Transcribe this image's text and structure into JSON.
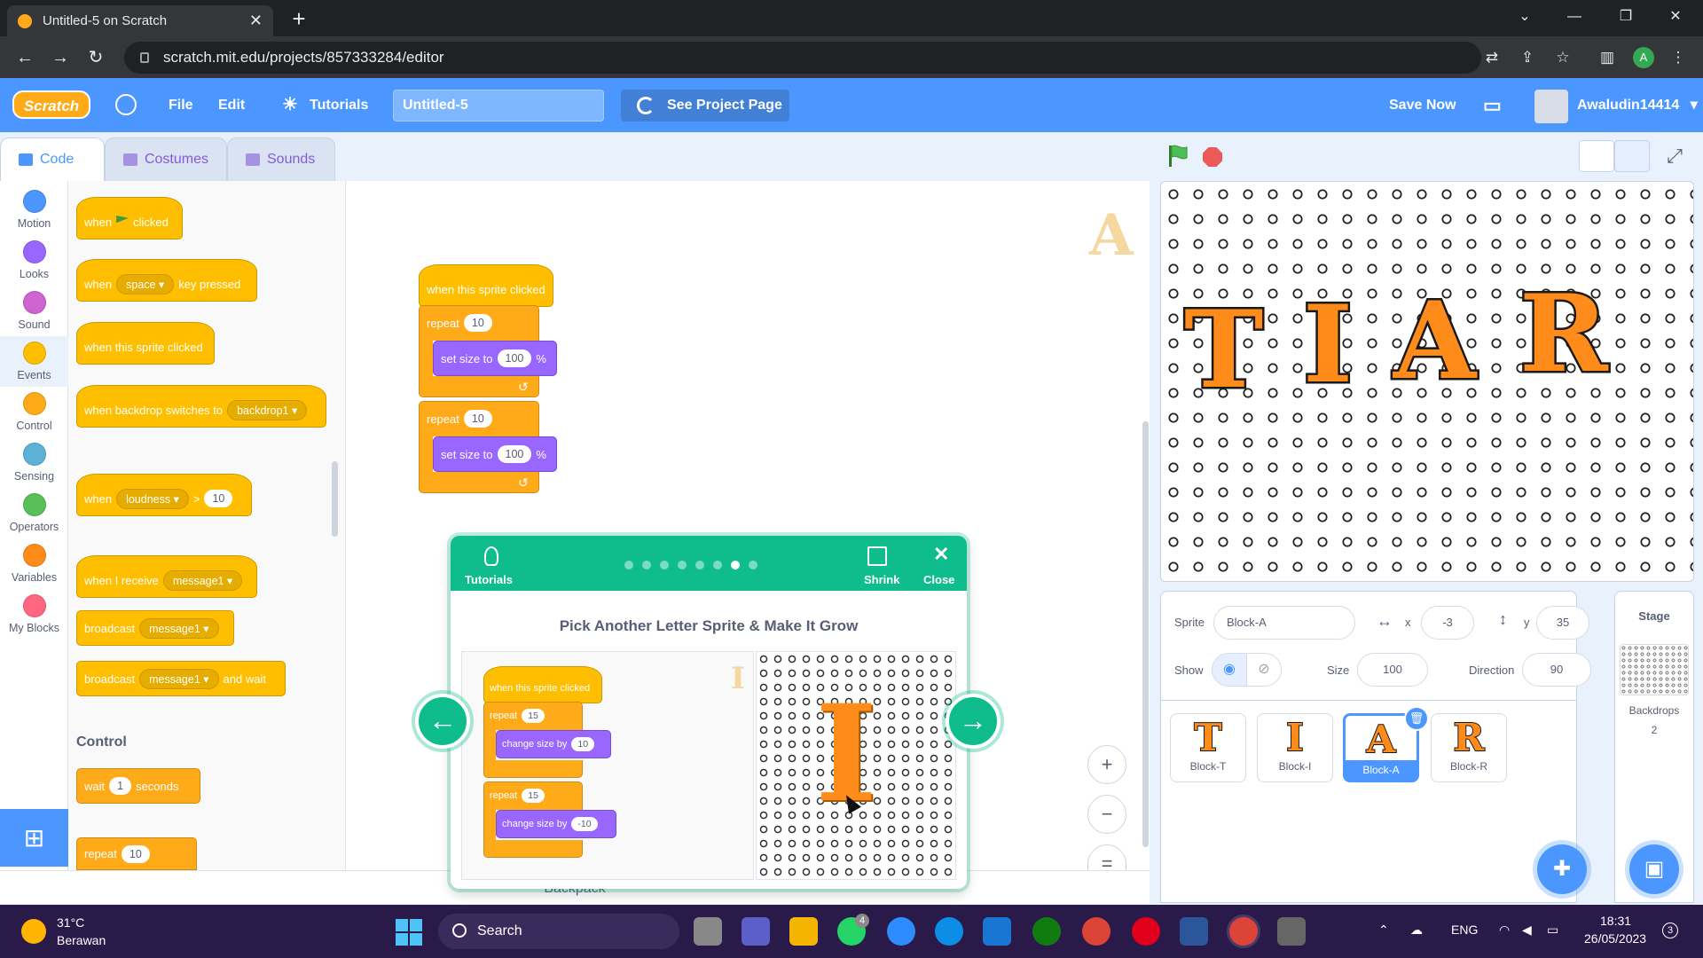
{
  "browser": {
    "tab_title": "Untitled-5 on Scratch",
    "tab_close": "✕",
    "new_tab": "+",
    "url": "scratch.mit.edu/projects/857333284/editor",
    "profile_initial": "A",
    "window_controls": [
      "⌄",
      "—",
      "❐",
      "✕"
    ]
  },
  "menubar": {
    "logo": "Scratch",
    "file": "File",
    "edit": "Edit",
    "tutorials": "Tutorials",
    "project_title": "Untitled-5",
    "see_project": "See Project Page",
    "save_now": "Save Now",
    "username": "Awaludin14414",
    "caret": "▾"
  },
  "tabs": {
    "code": "Code",
    "costumes": "Costumes",
    "sounds": "Sounds"
  },
  "categories": [
    {
      "label": "Motion",
      "color": "#4c97ff"
    },
    {
      "label": "Looks",
      "color": "#9966ff"
    },
    {
      "label": "Sound",
      "color": "#cf63cf"
    },
    {
      "label": "Events",
      "color": "#ffbf00"
    },
    {
      "label": "Control",
      "color": "#ffab19"
    },
    {
      "label": "Sensing",
      "color": "#5cb1d6"
    },
    {
      "label": "Operators",
      "color": "#59c059"
    },
    {
      "label": "Variables",
      "color": "#ff8c1a"
    },
    {
      "label": "My Blocks",
      "color": "#ff6680"
    }
  ],
  "palette": {
    "when": "when",
    "clicked": "clicked",
    "space": "space",
    "key_pressed": "key pressed",
    "when_sprite_clicked": "when this sprite clicked",
    "when_backdrop": "when backdrop switches to",
    "backdrop1": "backdrop1",
    "loudness": "loudness",
    "gt": ">",
    "loud_val": "10",
    "when_receive": "when I receive",
    "message1": "message1",
    "broadcast": "broadcast",
    "and_wait": "and wait",
    "control_heading": "Control",
    "wait": "wait",
    "wait_val": "1",
    "seconds": "seconds",
    "repeat": "repeat",
    "repeat_val": "10"
  },
  "workspace": {
    "hat": "when this sprite clicked",
    "repeat": "repeat",
    "repeat1_val": "10",
    "set_size": "set size to",
    "size1_val": "100",
    "pct": "%",
    "repeat2_val": "10",
    "size2_val": "100",
    "loop_arrow": "↺",
    "ghost_letter": "A",
    "zoom_in": "+",
    "zoom_out": "−",
    "zoom_reset": "="
  },
  "backpack": "Backpack",
  "tutorial": {
    "label": "Tutorials",
    "shrink": "Shrink",
    "close": "Close",
    "close_x": "✕",
    "title": "Pick Another Letter Sprite & Make It Grow",
    "dots_total": 8,
    "dots_active_index": 6,
    "hat": "when this sprite clicked",
    "repeat": "repeat",
    "repeat1_val": "15",
    "change_size": "change size by",
    "change1_val": "10",
    "repeat2_val": "15",
    "change2_val": "-10",
    "ghost_letter": "I",
    "stage_letter": "I",
    "prev_arrow": "←",
    "next_arrow": "→"
  },
  "stage": {
    "letters": [
      "T",
      "I",
      "A",
      "R"
    ]
  },
  "sprite_info": {
    "sprite_label": "Sprite",
    "sprite_name": "Block-A",
    "x_label": "x",
    "x_val": "-3",
    "y_label": "y",
    "y_val": "35",
    "show_label": "Show",
    "size_label": "Size",
    "size_val": "100",
    "direction_label": "Direction",
    "direction_val": "90"
  },
  "sprites": [
    {
      "letter": "T",
      "name": "Block-T"
    },
    {
      "letter": "I",
      "name": "Block-I"
    },
    {
      "letter": "A",
      "name": "Block-A"
    },
    {
      "letter": "R",
      "name": "Block-R"
    }
  ],
  "stage_panel": {
    "title": "Stage",
    "backdrops_label": "Backdrops",
    "backdrops_count": "2"
  },
  "taskbar": {
    "temp": "31°C",
    "weather": "Berawan",
    "search": "Search",
    "whatsapp_badge": "4",
    "lang": "ENG",
    "time": "18:31",
    "date": "26/05/2023",
    "notif": "3"
  }
}
